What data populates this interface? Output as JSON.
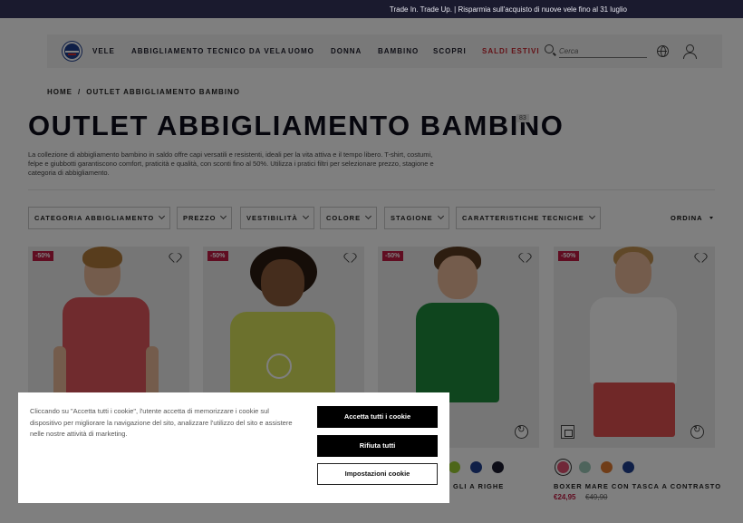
{
  "topbar": {
    "message": "Trade In. Trade Up. | Risparmia sull'acquisto di nuove vele fino al 31 luglio"
  },
  "nav": {
    "items": [
      "VELE",
      "ABBIGLIAMENTO TECNICO DA VELA",
      "UOMO",
      "DONNA",
      "BAMBINO",
      "SCOPRI",
      "SALDI ESTIVI"
    ],
    "search_placeholder": "Cerca"
  },
  "breadcrumb": {
    "home": "HOME",
    "separator": "/",
    "current": "OUTLET ABBIGLIAMENTO BAMBINO"
  },
  "page": {
    "title": "OUTLET ABBIGLIAMENTO BAMBINO",
    "count": "83",
    "intro": "La collezione di abbigliamento bambino in saldo offre capi versatili e resistenti, ideali per la vita attiva e il tempo libero. T-shirt, costumi, felpe e giubbotti garantiscono comfort, praticità e qualità, con sconti fino al 50%. Utilizza i pratici filtri per selezionare prezzo, stagione e categoria di abbigliamento."
  },
  "filters": [
    "CATEGORIA ABBIGLIAMENTO",
    "PREZZO",
    "VESTIBILITÀ",
    "COLORE",
    "STAGIONE",
    "CARATTERISTICHE TECNICHE"
  ],
  "sort_label": "ORDINA",
  "products": [
    {
      "badge": "-50%",
      "shirt_color": "#e0575c",
      "accent": "#1e2a5a",
      "hair": "#b07a3a",
      "shorts": "#ececec"
    },
    {
      "badge": "-50%",
      "shirt_color": "#d9e35a",
      "accent": "#ffffff",
      "hair": "#2a1a10",
      "shorts": "#ececec"
    },
    {
      "badge": "-50%",
      "shirt_color": "#1f8a3c",
      "accent": "#76c47e",
      "hair": "#5a3a20",
      "shorts": "#1f8a3c"
    },
    {
      "badge": "-50%",
      "shirt_color": "#ffffff",
      "accent": "#1e2a5a",
      "hair": "#c09050",
      "shorts": "#e05050"
    }
  ],
  "visible_swatches_product3": [
    "#9acd32",
    "#1f3f8f",
    "#1a1a2e"
  ],
  "visible_name_product3": "GLI A RIGHE",
  "product4": {
    "swatches": [
      "#e05070",
      "#9cc8b8",
      "#e07a30",
      "#1f3f8f"
    ],
    "name": "BOXER MARE CON TASCA A CONTRASTO",
    "price": "€24,95",
    "old_price": "€49,90"
  },
  "cookie": {
    "text": "Cliccando su \"Accetta tutti i cookie\", l'utente accetta di memorizzare i cookie sul dispositivo per migliorare la navigazione del sito, analizzare l'utilizzo del sito e assistere nelle nostre attività di marketing.",
    "accept": "Accetta tutti i cookie",
    "reject": "Rifiuta tutti",
    "settings": "Impostazioni cookie"
  }
}
